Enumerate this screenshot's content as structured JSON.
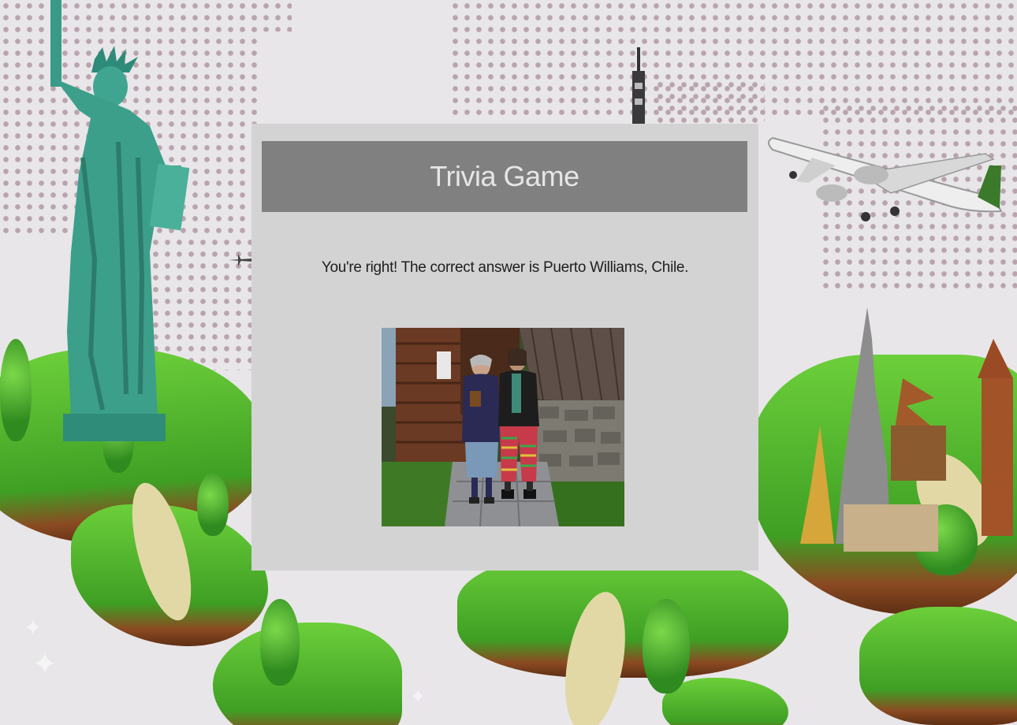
{
  "game": {
    "title": "Trivia Game",
    "result_message": "You're right! The correct answer is Puerto Williams, Chile."
  },
  "answer_image": {
    "icon": "photo-of-two-people-in-front-of-wooden-house"
  },
  "background": {
    "icon": "world-landmarks-travel-illustration"
  },
  "colors": {
    "card_background": "#d4d3d4",
    "header_background": "#808080",
    "header_text": "#e6e6e6",
    "message_text": "#1e1e1e"
  }
}
